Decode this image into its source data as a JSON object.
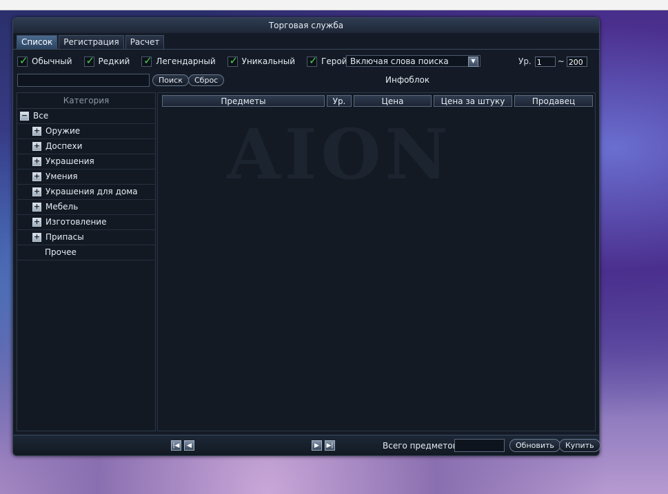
{
  "window": {
    "title": "Торговая служба"
  },
  "tabs": [
    {
      "label": "Список",
      "active": true
    },
    {
      "label": "Регистрация",
      "active": false
    },
    {
      "label": "Расчет",
      "active": false
    }
  ],
  "filters": [
    {
      "label": "Обычный",
      "checked": true
    },
    {
      "label": "Редкий",
      "checked": true
    },
    {
      "label": "Легендарный",
      "checked": true
    },
    {
      "label": "Уникальный",
      "checked": true
    },
    {
      "label": "Герой",
      "checked": true
    }
  ],
  "search_mode": {
    "selected": "Включая слова поиска"
  },
  "level": {
    "label": "Ур.",
    "min": "1",
    "separator": "~",
    "max": "200"
  },
  "search": {
    "value": "",
    "search_button": "Поиск",
    "reset_button": "Сброс"
  },
  "infoblock": {
    "title": "Инфоблок"
  },
  "sidebar": {
    "header": "Категория",
    "root": {
      "label": "Все",
      "expanded": true
    },
    "items": [
      {
        "label": "Оружие"
      },
      {
        "label": "Доспехи"
      },
      {
        "label": "Украшения"
      },
      {
        "label": "Умения"
      },
      {
        "label": "Украшения для дома"
      },
      {
        "label": "Мебель"
      },
      {
        "label": "Изготовление"
      },
      {
        "label": "Припасы"
      }
    ],
    "other": "Прочее"
  },
  "table": {
    "columns": [
      "Предметы",
      "Ур.",
      "Цена",
      "Цена за штуку",
      "Продавец"
    ],
    "rows": []
  },
  "footer": {
    "total_label": "Всего предметов",
    "total_value": "",
    "refresh_button": "Обновить",
    "buy_button": "Купить"
  },
  "watermark": "AION"
}
